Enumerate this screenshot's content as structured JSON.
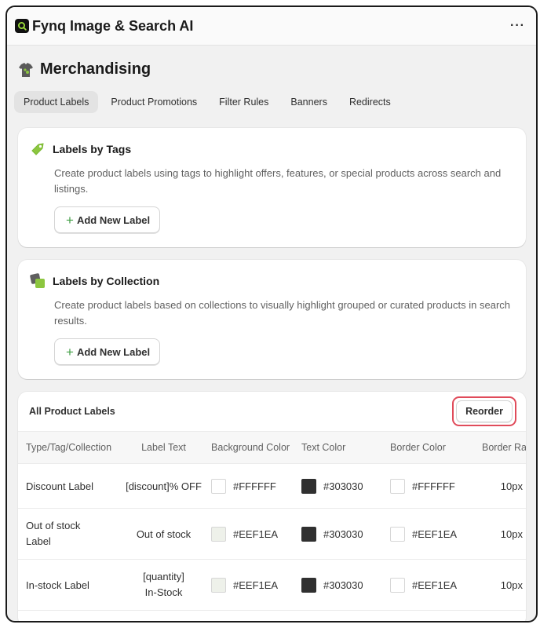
{
  "app": {
    "title": "Fynq Image & Search AI",
    "more": "···"
  },
  "page": {
    "title": "Merchandising"
  },
  "tabs": [
    {
      "label": "Product Labels",
      "active": true
    },
    {
      "label": "Product Promotions",
      "active": false
    },
    {
      "label": "Filter Rules",
      "active": false
    },
    {
      "label": "Banners",
      "active": false
    },
    {
      "label": "Redirects",
      "active": false
    }
  ],
  "tag_card": {
    "title": "Labels by Tags",
    "description": "Create product labels using tags to highlight offers, features, or special products across search and listings.",
    "button": "Add New Label",
    "icon": "tag-icon"
  },
  "collection_card": {
    "title": "Labels by Collection",
    "description": "Create product labels based on collections to visually highlight grouped or curated products in search results.",
    "button": "Add New Label",
    "icon": "collection-icon"
  },
  "table": {
    "title": "All Product Labels",
    "reorder": "Reorder",
    "columns": [
      "Type/Tag/Collection",
      "Label Text",
      "Background Color",
      "Text Color",
      "Border Color",
      "Border Radius"
    ],
    "rows": [
      {
        "type": "Discount Label",
        "label_text": "[discount]% OFF",
        "bg": "#FFFFFF",
        "text": "#303030",
        "border": "#FFFFFF",
        "radius": "10px"
      },
      {
        "type": "Out of stock Label",
        "label_text": "Out of stock",
        "bg": "#EEF1EA",
        "text": "#303030",
        "border": "#EEF1EA",
        "radius": "10px"
      },
      {
        "type": "In-stock Label",
        "label_text": "[quantity] In-Stock",
        "bg": "#EEF1EA",
        "text": "#303030",
        "border": "#EEF1EA",
        "radius": "10px"
      }
    ]
  },
  "colors": {
    "accent_green": "#8cc63f",
    "highlight_red": "#e04b5a",
    "app_bg": "#f1f1f1"
  }
}
